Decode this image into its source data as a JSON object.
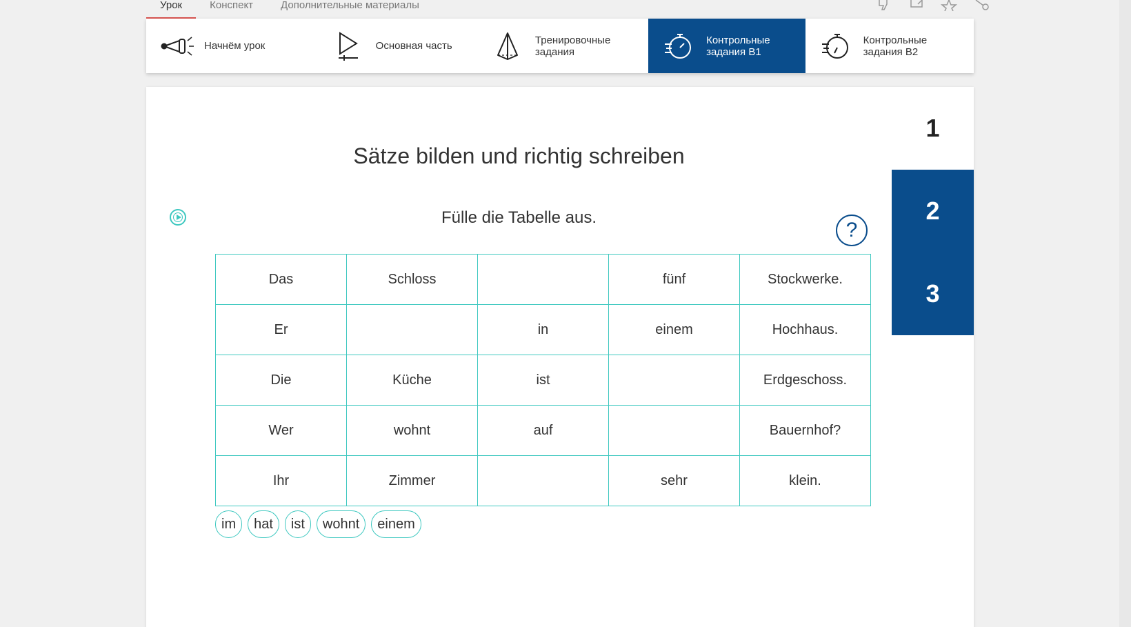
{
  "top_tabs": [
    "Урок",
    "Конспект",
    "Дополнительные материалы"
  ],
  "top_icons": [
    "thumbs-down-icon",
    "export-icon",
    "star-icon",
    "share-icon"
  ],
  "nav": [
    {
      "label": "Начнём урок",
      "icon": "megaphone-icon"
    },
    {
      "label": "Основная часть",
      "icon": "play-icon"
    },
    {
      "label": "Тренировочные\nзадания",
      "icon": "pyramid-icon"
    },
    {
      "label": "Контрольные\nзадания В1",
      "icon": "stopwatch-icon",
      "active": true
    },
    {
      "label": "Контрольные\nзадания В2",
      "icon": "stopwatch-icon"
    }
  ],
  "content": {
    "title": "Sätze bilden und richtig schreiben",
    "instruction": "Fülle die Tabelle aus.",
    "help_label": "?"
  },
  "steps": [
    "1",
    "2",
    "3"
  ],
  "table": {
    "rows": [
      [
        "Das",
        "Schloss",
        "",
        "fünf",
        "Stockwerke."
      ],
      [
        "Er",
        "",
        "in",
        "einem",
        "Hochhaus."
      ],
      [
        "Die",
        "Küche",
        "ist",
        "",
        "Erdgeschoss."
      ],
      [
        "Wer",
        "wohnt",
        "auf",
        "",
        "Bauernhof?"
      ],
      [
        "Ihr",
        "Zimmer",
        "",
        "sehr",
        "klein."
      ]
    ]
  },
  "chips": [
    "im",
    "hat",
    "ist",
    "wohnt",
    "einem"
  ],
  "colors": {
    "accent": "#0a4d8c",
    "teal": "#3ec8c0",
    "tab_underline": "#d9534f"
  }
}
